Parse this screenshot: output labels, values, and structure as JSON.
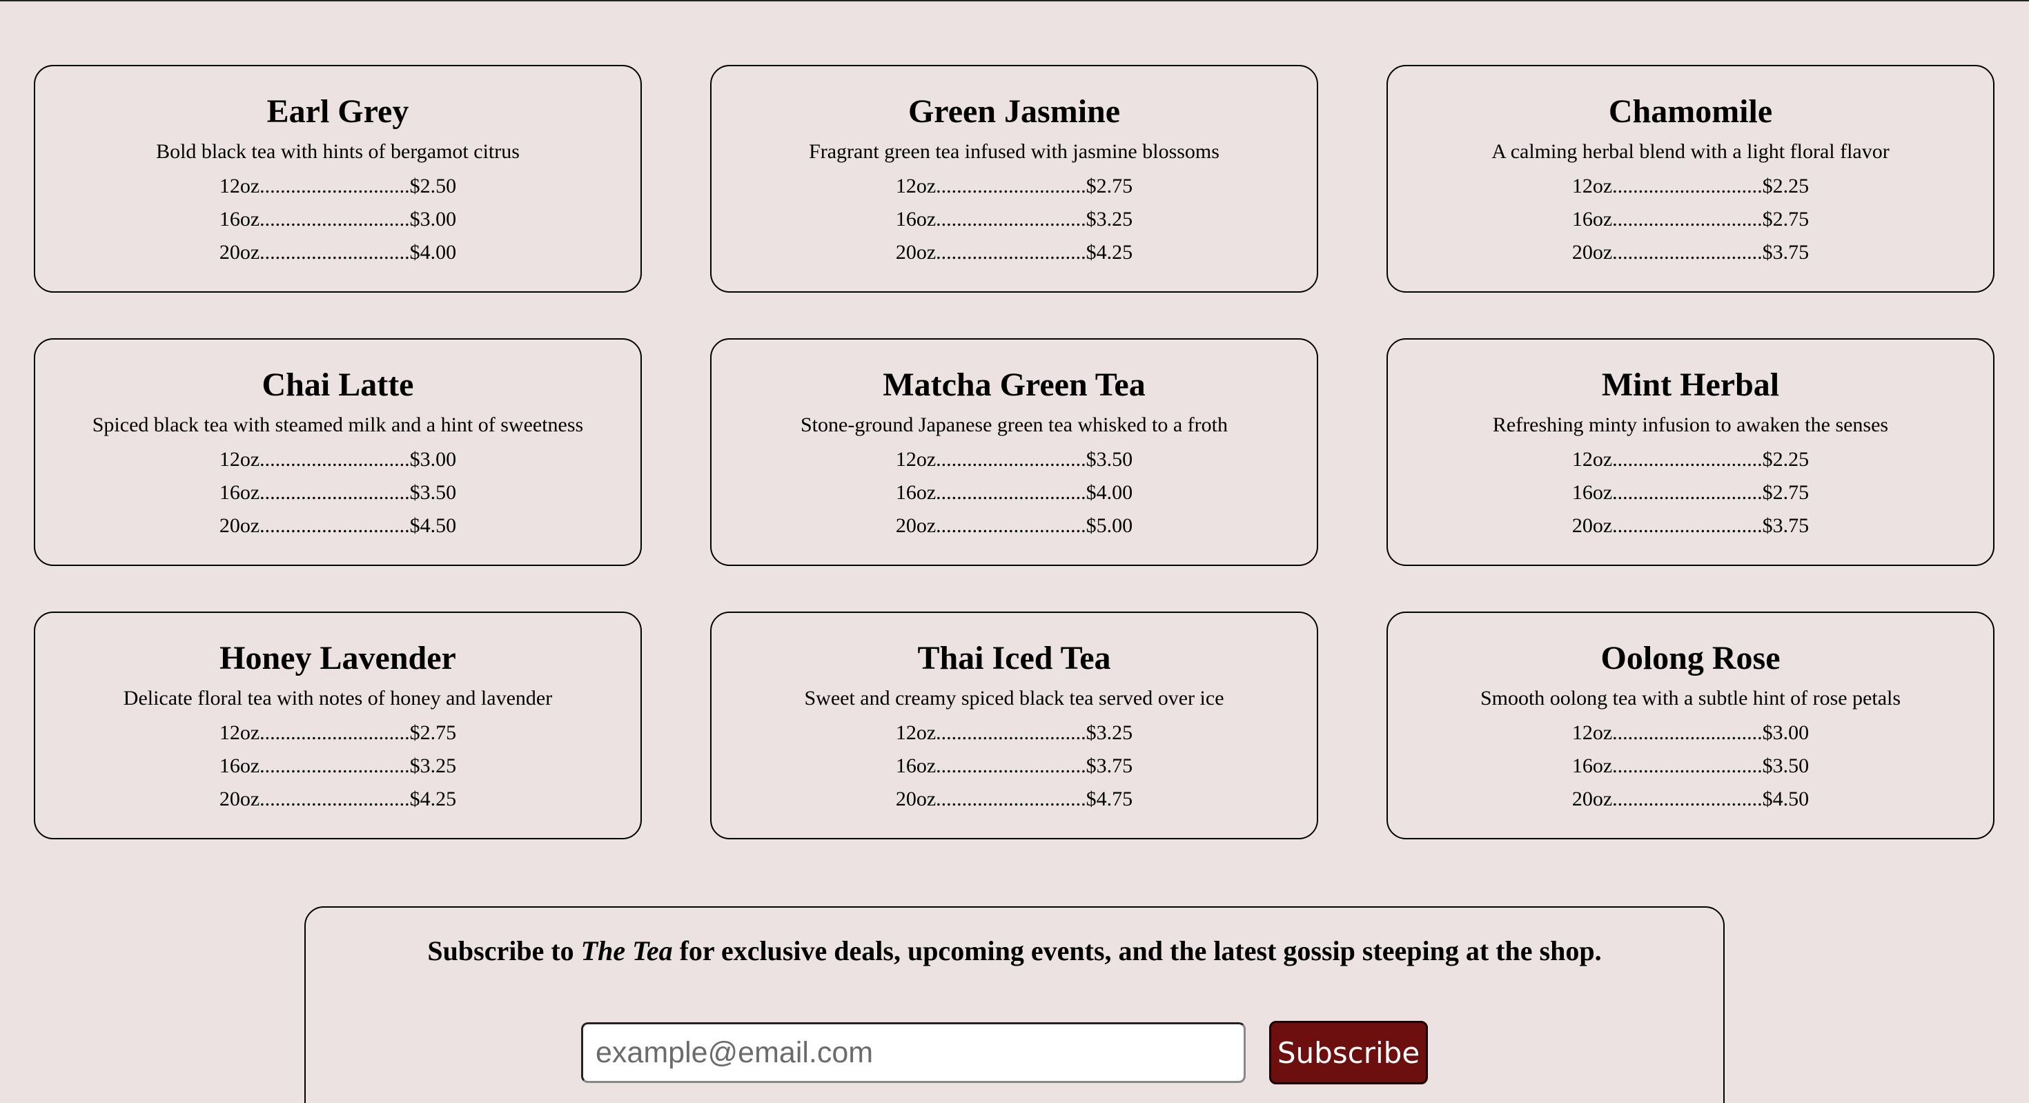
{
  "menu": {
    "teas": [
      {
        "name": "Earl Grey",
        "description": "Bold black tea with hints of bergamot citrus",
        "prices": [
          {
            "label": "12oz.............................$2.50"
          },
          {
            "label": "16oz.............................$3.00"
          },
          {
            "label": "20oz.............................$4.00"
          }
        ]
      },
      {
        "name": "Green Jasmine",
        "description": "Fragrant green tea infused with jasmine blossoms",
        "prices": [
          {
            "label": "12oz.............................$2.75"
          },
          {
            "label": "16oz.............................$3.25"
          },
          {
            "label": "20oz.............................$4.25"
          }
        ]
      },
      {
        "name": "Chamomile",
        "description": "A calming herbal blend with a light floral flavor",
        "prices": [
          {
            "label": "12oz.............................$2.25"
          },
          {
            "label": "16oz.............................$2.75"
          },
          {
            "label": "20oz.............................$3.75"
          }
        ]
      },
      {
        "name": "Chai Latte",
        "description": "Spiced black tea with steamed milk and a hint of sweetness",
        "prices": [
          {
            "label": "12oz.............................$3.00"
          },
          {
            "label": "16oz.............................$3.50"
          },
          {
            "label": "20oz.............................$4.50"
          }
        ]
      },
      {
        "name": "Matcha Green Tea",
        "description": "Stone-ground Japanese green tea whisked to a froth",
        "prices": [
          {
            "label": "12oz.............................$3.50"
          },
          {
            "label": "16oz.............................$4.00"
          },
          {
            "label": "20oz.............................$5.00"
          }
        ]
      },
      {
        "name": "Mint Herbal",
        "description": "Refreshing minty infusion to awaken the senses",
        "prices": [
          {
            "label": "12oz.............................$2.25"
          },
          {
            "label": "16oz.............................$2.75"
          },
          {
            "label": "20oz.............................$3.75"
          }
        ]
      },
      {
        "name": "Honey Lavender",
        "description": "Delicate floral tea with notes of honey and lavender",
        "prices": [
          {
            "label": "12oz.............................$2.75"
          },
          {
            "label": "16oz.............................$3.25"
          },
          {
            "label": "20oz.............................$4.25"
          }
        ]
      },
      {
        "name": "Thai Iced Tea",
        "description": "Sweet and creamy spiced black tea served over ice",
        "prices": [
          {
            "label": "12oz.............................$3.25"
          },
          {
            "label": "16oz.............................$3.75"
          },
          {
            "label": "20oz.............................$4.75"
          }
        ]
      },
      {
        "name": "Oolong Rose",
        "description": "Smooth oolong tea with a subtle hint of rose petals",
        "prices": [
          {
            "label": "12oz.............................$3.00"
          },
          {
            "label": "16oz.............................$3.50"
          },
          {
            "label": "20oz.............................$4.50"
          }
        ]
      }
    ]
  },
  "subscribe": {
    "text_before": "Subscribe to ",
    "brand": "The Tea",
    "text_after": " for exclusive deals, upcoming events, and the latest gossip steeping at the shop.",
    "email_placeholder": "example@email.com",
    "email_value": "",
    "button_label": "Subscribe"
  },
  "colors": {
    "background": "#ece2e1",
    "button": "#6e0f0f"
  }
}
